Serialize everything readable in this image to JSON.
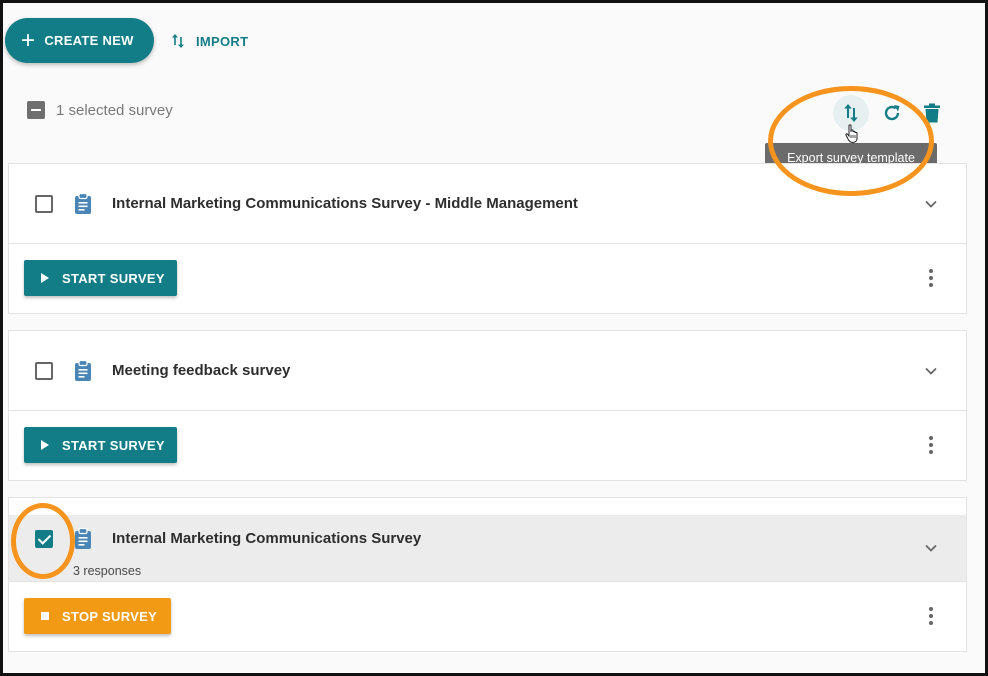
{
  "toolbar": {
    "create_label": "CREATE NEW",
    "import_label": "IMPORT"
  },
  "selection": {
    "text": "1 selected survey"
  },
  "tooltip": {
    "text": "Export survey template"
  },
  "surveys": [
    {
      "title": "Internal Marketing Communications Survey - Middle Management",
      "checked": false,
      "responses": "",
      "action": "START SURVEY"
    },
    {
      "title": "Meeting feedback survey",
      "checked": false,
      "responses": "",
      "action": "START SURVEY"
    },
    {
      "title": "Internal Marketing Communications Survey",
      "checked": true,
      "responses": "3 responses",
      "action": "STOP SURVEY"
    }
  ],
  "colors": {
    "primary": "#127d86",
    "stop": "#f29a14",
    "highlight_ring": "#f7941d",
    "doc_icon": "#4a86b5"
  },
  "icons": {
    "create": "plus-icon",
    "import": "import-arrows-icon",
    "export": "export-arrows-icon",
    "refresh": "refresh-icon",
    "delete": "trash-icon",
    "survey": "clipboard-icon",
    "expand": "chevron-down-icon",
    "menu": "kebab-menu-icon",
    "start": "play-icon",
    "stop": "stop-icon"
  }
}
